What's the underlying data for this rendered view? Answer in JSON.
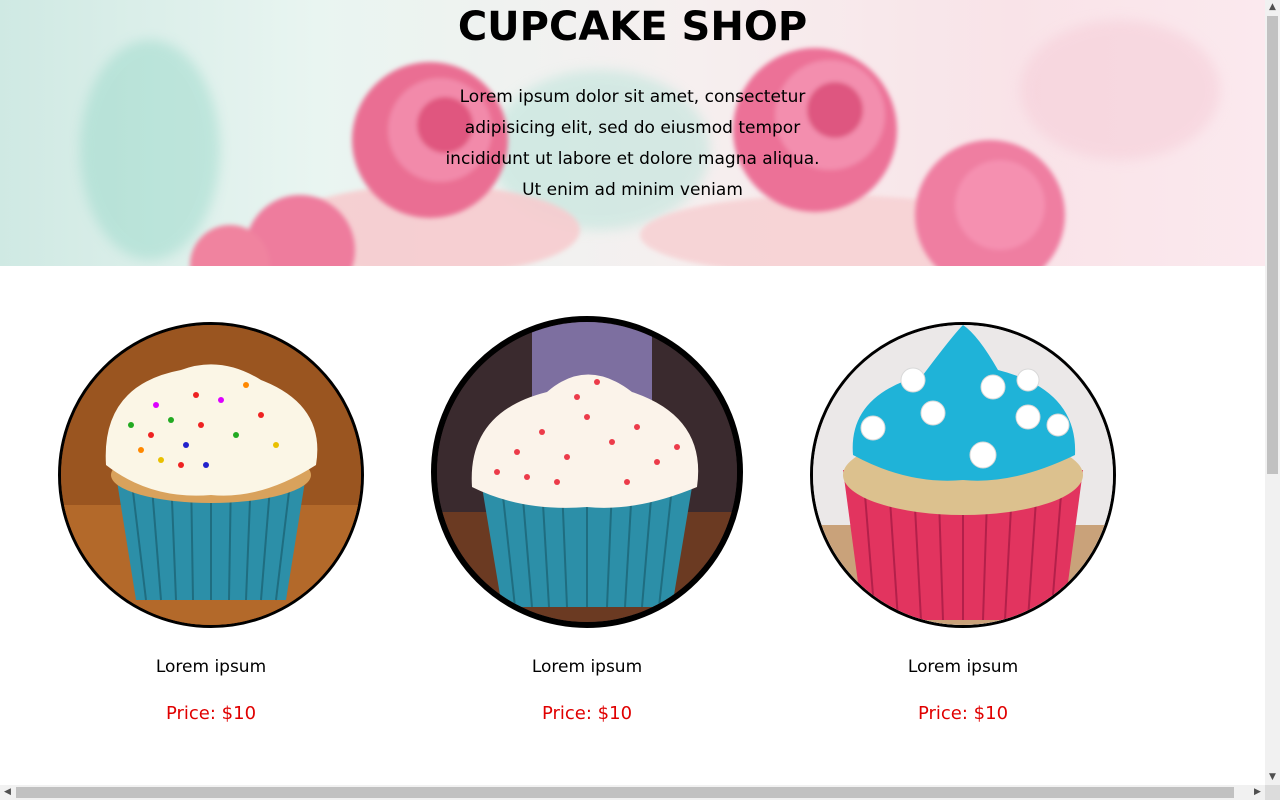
{
  "hero": {
    "title": "CUPCAKE SHOP",
    "description": "Lorem ipsum dolor sit amet, consectetur adipisicing elit, sed do eiusmod tempor incididunt ut labore et dolore magna aliqua. Ut enim ad minim veniam"
  },
  "products": [
    {
      "name": "Lorem ipsum",
      "price": "Price: $10",
      "frosting": "white-sprinkles",
      "wrapper": "teal"
    },
    {
      "name": "Lorem ipsum",
      "price": "Price: $10",
      "frosting": "white-red-sprinkles",
      "wrapper": "teal"
    },
    {
      "name": "Lorem ipsum",
      "price": "Price: $10",
      "frosting": "blue-pearls",
      "wrapper": "pink"
    }
  ],
  "colors": {
    "price": "#e00000",
    "rose_pink": "#ef7a9e",
    "frosting_blue": "#1fb3d8",
    "wrapper_teal": "#2c8fa8",
    "wrapper_pink": "#e2345f"
  }
}
